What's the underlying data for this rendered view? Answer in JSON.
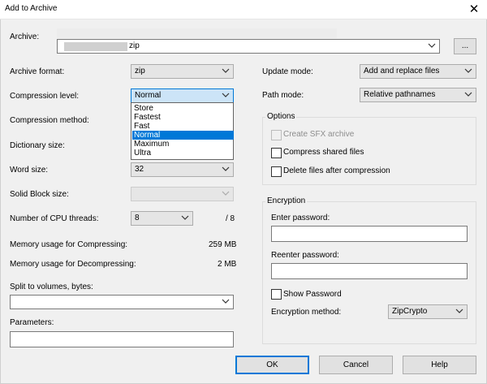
{
  "window": {
    "title": "Add to Archive",
    "close_glyph": "✕"
  },
  "archive": {
    "label": "Archive:",
    "value_suffix": "zip",
    "browse_label": "..."
  },
  "left": {
    "archive_format": {
      "label": "Archive format:",
      "value": "zip"
    },
    "compression_level": {
      "label": "Compression level:",
      "value": "Normal",
      "options": [
        "Store",
        "Fastest",
        "Fast",
        "Normal",
        "Maximum",
        "Ultra"
      ],
      "selected_index": 3
    },
    "compression_method": {
      "label": "Compression method:"
    },
    "dictionary_size": {
      "label": "Dictionary size:"
    },
    "word_size": {
      "label": "Word size:",
      "value": "32"
    },
    "solid_block_size": {
      "label": "Solid Block size:",
      "value": ""
    },
    "cpu_threads": {
      "label": "Number of CPU threads:",
      "value": "8",
      "max": "/ 8"
    },
    "mem_compress": {
      "label": "Memory usage for Compressing:",
      "value": "259 MB"
    },
    "mem_decompress": {
      "label": "Memory usage for Decompressing:",
      "value": "2 MB"
    },
    "split_volumes": {
      "label": "Split to volumes, bytes:",
      "value": ""
    },
    "parameters": {
      "label": "Parameters:",
      "value": ""
    }
  },
  "right": {
    "update_mode": {
      "label": "Update mode:",
      "value": "Add and replace files"
    },
    "path_mode": {
      "label": "Path mode:",
      "value": "Relative pathnames"
    },
    "options": {
      "title": "Options",
      "create_sfx": {
        "label": "Create SFX archive",
        "checked": false,
        "enabled": false
      },
      "compress_shared": {
        "label": "Compress shared files",
        "checked": false
      },
      "delete_after": {
        "label": "Delete files after compression",
        "checked": false
      }
    },
    "encryption": {
      "title": "Encryption",
      "enter_password": {
        "label": "Enter password:",
        "value": ""
      },
      "reenter_password": {
        "label": "Reenter password:",
        "value": ""
      },
      "show_password": {
        "label": "Show Password",
        "checked": false
      },
      "method": {
        "label": "Encryption method:",
        "value": "ZipCrypto"
      }
    }
  },
  "buttons": {
    "ok": "OK",
    "cancel": "Cancel",
    "help": "Help"
  },
  "icons": {
    "dropdown": "chevron-down-icon",
    "close": "close-icon"
  },
  "colors": {
    "selection": "#0078d7",
    "default_button_border": "#0078d7"
  }
}
